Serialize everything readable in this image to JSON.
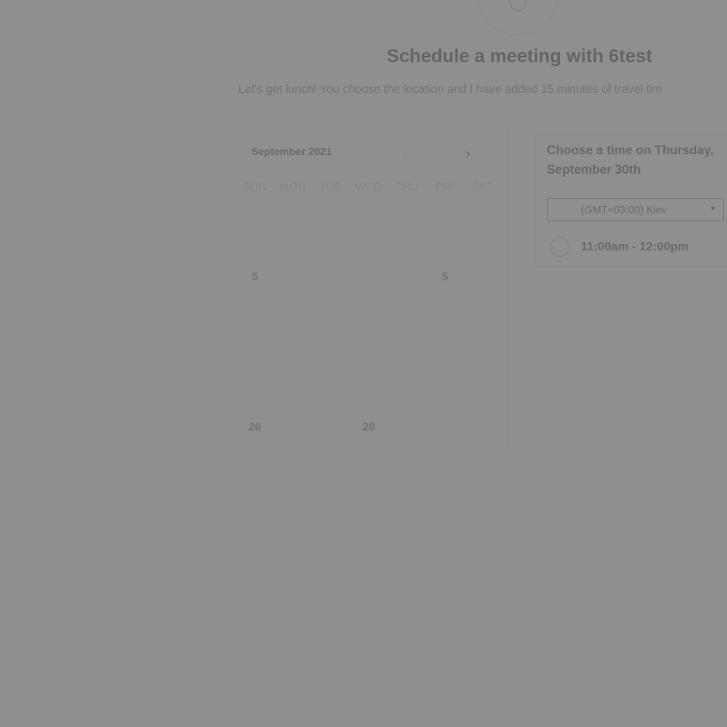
{
  "header": {
    "avatar_icon": "user-avatar-placeholder",
    "title": "Schedule a meeting with 6test",
    "subtitle": "Let's get lunch! You choose the location and I have added 15 minutes of travel tim"
  },
  "calendar": {
    "month_label": "September 2021",
    "prev_icon": "chevron-left",
    "next_icon": "chevron-right",
    "weekdays": [
      "SUN",
      "MON",
      "TUE",
      "WED",
      "THU",
      "FRI",
      "SAT"
    ],
    "weeks": [
      [
        "",
        "",
        "",
        "",
        "",
        "",
        ""
      ],
      [
        "5",
        "",
        "",
        "",
        "",
        "5",
        ""
      ],
      [
        "",
        "",
        "",
        "",
        "",
        "",
        ""
      ],
      [
        "",
        "",
        "",
        "",
        "",
        "",
        ""
      ],
      [
        "26",
        "",
        "",
        "28",
        "",
        "",
        ""
      ]
    ]
  },
  "time_panel": {
    "heading": "Choose a time on Thursday, September 30th",
    "timezone": "(GMT+03:00) Kiev",
    "timezone_caret_icon": "caret-down",
    "slots": [
      "11:00am - 12:00pm"
    ]
  },
  "colors": {
    "overlay": "#8f8f8f"
  }
}
